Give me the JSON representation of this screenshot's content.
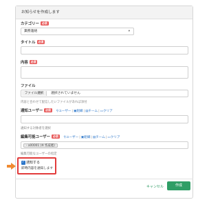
{
  "header": {
    "title": "お知らせを作成します"
  },
  "required_badge": "必須",
  "category": {
    "label": "カテゴリー",
    "value": "業務連絡"
  },
  "title_field": {
    "label": "タイトル",
    "value": ""
  },
  "content_field": {
    "label": "内容",
    "value": ""
  },
  "file_field": {
    "label": "ファイル",
    "button": "ファイル選択",
    "status": "選択されていません",
    "help": "内容と合わせて配信したいファイルがあれば添付"
  },
  "notify_users": {
    "label": "通知ユーザー",
    "links": [
      "ユーザー",
      "組織",
      "チーム",
      "クリア"
    ],
    "value": "",
    "help": "通知する対象者を選択"
  },
  "editors": {
    "label": "編集可能ユーザー",
    "links": [
      "ユーザー",
      "組織",
      "チーム",
      "クリア"
    ],
    "tag": "- a00001 (※ 作成者)",
    "help": "編集可能なユーザーの指定"
  },
  "notify_option": {
    "label": "通知する",
    "help": "即時内容を通知します",
    "checked": true
  },
  "footer": {
    "cancel": "キャンセル",
    "create": "作成"
  },
  "colors": {
    "accent_green": "#2f9e66",
    "link_blue": "#2c76c9",
    "required_red": "#e85a5a",
    "highlight_red": "#e23a3a"
  }
}
